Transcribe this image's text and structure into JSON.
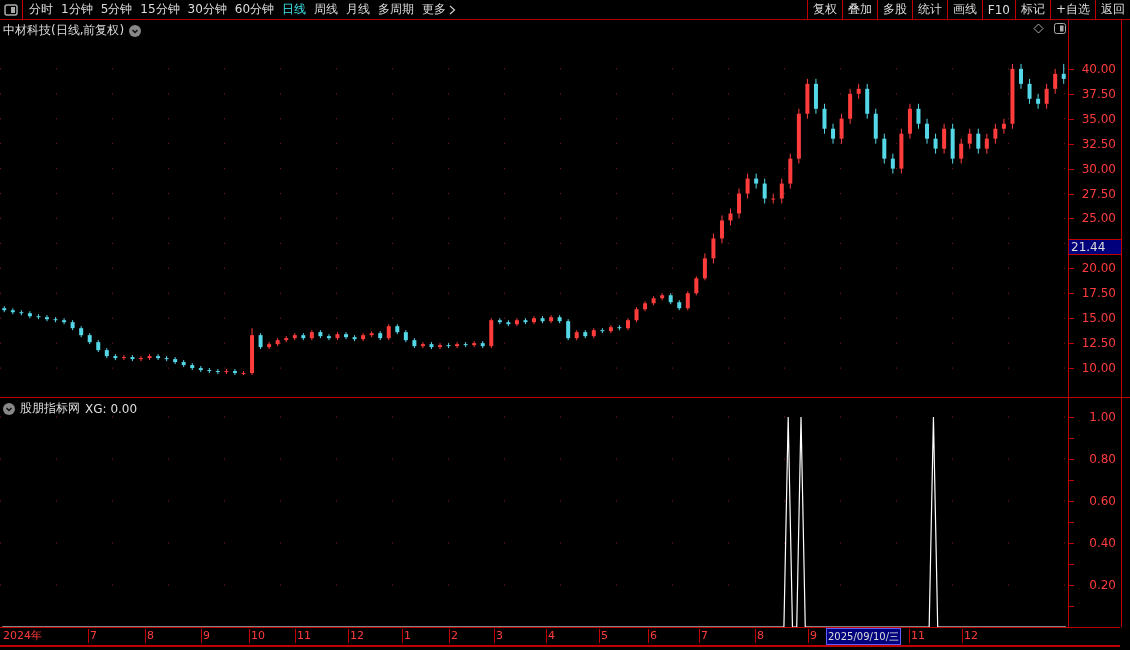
{
  "toolbar": {
    "periods": [
      {
        "label": "分时",
        "selected": false
      },
      {
        "label": "1分钟",
        "selected": false
      },
      {
        "label": "5分钟",
        "selected": false
      },
      {
        "label": "15分钟",
        "selected": false
      },
      {
        "label": "30分钟",
        "selected": false
      },
      {
        "label": "60分钟",
        "selected": false
      },
      {
        "label": "日线",
        "selected": true
      },
      {
        "label": "周线",
        "selected": false
      },
      {
        "label": "月线",
        "selected": false
      },
      {
        "label": "多周期",
        "selected": false
      },
      {
        "label": "更多",
        "selected": false
      }
    ],
    "actions": [
      "复权",
      "叠加",
      "多股",
      "统计",
      "画线",
      "F10",
      "标记",
      "+自选",
      "返回"
    ]
  },
  "price_pane": {
    "title": "中材科技(日线,前复权)",
    "cursor_price": "21.44",
    "chart_data": {
      "type": "candlestick",
      "grid": true,
      "ylim": [
        7.1,
        44.9
      ],
      "yticks": [
        {
          "value": 40,
          "label": "40.00"
        },
        {
          "value": 37.5,
          "label": "37.50"
        },
        {
          "value": 35,
          "label": "35.00"
        },
        {
          "value": 32.5,
          "label": "32.50"
        },
        {
          "value": 30,
          "label": "30.00"
        },
        {
          "value": 27.5,
          "label": "27.50"
        },
        {
          "value": 25,
          "label": "25.00"
        },
        {
          "value": 20,
          "label": "20.00"
        },
        {
          "value": 17.5,
          "label": "17.50"
        },
        {
          "value": 15,
          "label": "15.00"
        },
        {
          "value": 12.5,
          "label": "12.50"
        },
        {
          "value": 10,
          "label": "10.00"
        }
      ],
      "categories": [
        null,
        null,
        null,
        null,
        null,
        null,
        null,
        null,
        null,
        null,
        null,
        null,
        null,
        null,
        null,
        null,
        null,
        null,
        null,
        null,
        null,
        null,
        null,
        null,
        null,
        null,
        null,
        null,
        null,
        null,
        null,
        null,
        null,
        null,
        null,
        null,
        null,
        null,
        null,
        null,
        null,
        null,
        null,
        null,
        null,
        null,
        null,
        null,
        null,
        null,
        null,
        null,
        null,
        null,
        null,
        null,
        null,
        null,
        null,
        null,
        null,
        null,
        null,
        null,
        null,
        null,
        null,
        null,
        null,
        null,
        null,
        null,
        null,
        null,
        null,
        null,
        null,
        null,
        null,
        null,
        null,
        null,
        null,
        null,
        null,
        null,
        null,
        null,
        null,
        null,
        null,
        null,
        null,
        null,
        null,
        null,
        null,
        null,
        null,
        null,
        null,
        null,
        null,
        null,
        null,
        null,
        null,
        null,
        null,
        null,
        null,
        null,
        null,
        null,
        null,
        null,
        null,
        null,
        null,
        null,
        null,
        null,
        null,
        null,
        null
      ],
      "ohlc": [
        [
          16.0,
          16.2,
          15.6,
          15.8
        ],
        [
          15.8,
          16.0,
          15.4,
          15.6
        ],
        [
          15.6,
          15.8,
          15.3,
          15.5
        ],
        [
          15.5,
          15.7,
          15.0,
          15.2
        ],
        [
          15.2,
          15.4,
          14.9,
          15.1
        ],
        [
          15.1,
          15.3,
          14.7,
          14.9
        ],
        [
          14.9,
          15.1,
          14.6,
          14.8
        ],
        [
          14.8,
          15.0,
          14.4,
          14.6
        ],
        [
          14.6,
          14.8,
          13.8,
          14.0
        ],
        [
          14.0,
          14.2,
          13.1,
          13.3
        ],
        [
          13.3,
          13.5,
          12.4,
          12.6
        ],
        [
          12.6,
          12.8,
          11.6,
          11.8
        ],
        [
          11.8,
          12.0,
          11.0,
          11.2
        ],
        [
          11.2,
          11.4,
          10.8,
          11.0
        ],
        [
          11.0,
          11.3,
          10.8,
          11.1
        ],
        [
          11.1,
          11.3,
          10.7,
          10.9
        ],
        [
          10.9,
          11.2,
          10.7,
          11.0
        ],
        [
          11.0,
          11.4,
          10.8,
          11.2
        ],
        [
          11.2,
          11.4,
          10.8,
          11.0
        ],
        [
          11.0,
          11.2,
          10.7,
          10.9
        ],
        [
          10.9,
          11.1,
          10.4,
          10.6
        ],
        [
          10.6,
          10.8,
          10.1,
          10.3
        ],
        [
          10.3,
          10.5,
          9.8,
          10.0
        ],
        [
          10.0,
          10.2,
          9.6,
          9.8
        ],
        [
          9.8,
          10.0,
          9.5,
          9.7
        ],
        [
          9.7,
          9.9,
          9.4,
          9.6
        ],
        [
          9.6,
          9.9,
          9.4,
          9.7
        ],
        [
          9.7,
          9.9,
          9.3,
          9.5
        ],
        [
          9.5,
          9.7,
          9.3,
          9.5
        ],
        [
          9.5,
          14.0,
          9.3,
          13.3
        ],
        [
          13.3,
          13.5,
          11.9,
          12.1
        ],
        [
          12.1,
          12.6,
          11.9,
          12.4
        ],
        [
          12.4,
          13.0,
          12.2,
          12.8
        ],
        [
          12.8,
          13.2,
          12.6,
          13.0
        ],
        [
          13.0,
          13.5,
          12.8,
          13.3
        ],
        [
          13.3,
          13.5,
          12.8,
          13.0
        ],
        [
          13.0,
          13.8,
          12.8,
          13.6
        ],
        [
          13.6,
          13.8,
          13.0,
          13.2
        ],
        [
          13.2,
          13.4,
          12.8,
          13.0
        ],
        [
          13.0,
          13.6,
          12.8,
          13.4
        ],
        [
          13.4,
          13.6,
          12.9,
          13.1
        ],
        [
          13.1,
          13.3,
          12.7,
          12.9
        ],
        [
          12.9,
          13.5,
          12.7,
          13.3
        ],
        [
          13.3,
          13.7,
          13.1,
          13.5
        ],
        [
          13.5,
          13.7,
          12.8,
          13.0
        ],
        [
          13.0,
          14.4,
          12.8,
          14.2
        ],
        [
          14.2,
          14.4,
          13.4,
          13.6
        ],
        [
          13.6,
          13.8,
          12.6,
          12.8
        ],
        [
          12.8,
          13.0,
          12.0,
          12.2
        ],
        [
          12.2,
          12.6,
          12.0,
          12.4
        ],
        [
          12.4,
          12.6,
          11.9,
          12.1
        ],
        [
          12.1,
          12.5,
          11.9,
          12.3
        ],
        [
          12.3,
          12.5,
          12.0,
          12.2
        ],
        [
          12.2,
          12.6,
          12.0,
          12.4
        ],
        [
          12.4,
          12.6,
          12.1,
          12.3
        ],
        [
          12.3,
          12.7,
          12.1,
          12.5
        ],
        [
          12.5,
          12.7,
          12.0,
          12.2
        ],
        [
          12.2,
          15.0,
          12.0,
          14.8
        ],
        [
          14.8,
          15.0,
          14.4,
          14.6
        ],
        [
          14.6,
          14.8,
          14.2,
          14.4
        ],
        [
          14.4,
          15.0,
          14.2,
          14.8
        ],
        [
          14.8,
          15.0,
          14.4,
          14.6
        ],
        [
          14.6,
          15.2,
          14.4,
          15.0
        ],
        [
          15.0,
          15.2,
          14.5,
          14.7
        ],
        [
          14.7,
          15.3,
          14.5,
          15.1
        ],
        [
          15.1,
          15.3,
          14.5,
          14.7
        ],
        [
          14.7,
          14.9,
          12.8,
          13.0
        ],
        [
          13.0,
          13.8,
          12.8,
          13.6
        ],
        [
          13.6,
          13.8,
          13.0,
          13.2
        ],
        [
          13.2,
          14.0,
          13.0,
          13.8
        ],
        [
          13.8,
          14.0,
          13.5,
          13.7
        ],
        [
          13.7,
          14.3,
          13.5,
          14.1
        ],
        [
          14.1,
          14.3,
          13.8,
          14.0
        ],
        [
          14.0,
          15.0,
          13.8,
          14.8
        ],
        [
          14.8,
          16.1,
          14.6,
          15.9
        ],
        [
          15.9,
          16.7,
          15.7,
          16.5
        ],
        [
          16.5,
          17.2,
          16.3,
          17.0
        ],
        [
          17.0,
          17.5,
          16.8,
          17.3
        ],
        [
          17.3,
          17.5,
          16.4,
          16.6
        ],
        [
          16.6,
          16.8,
          15.8,
          16.0
        ],
        [
          16.0,
          17.7,
          15.8,
          17.5
        ],
        [
          17.5,
          19.2,
          17.3,
          19.0
        ],
        [
          19.0,
          21.5,
          18.8,
          21.0
        ],
        [
          21.0,
          23.5,
          20.5,
          23.0
        ],
        [
          23.0,
          25.3,
          22.5,
          24.8
        ],
        [
          24.8,
          26.0,
          24.3,
          25.5
        ],
        [
          25.5,
          28.0,
          25.0,
          27.5
        ],
        [
          27.5,
          29.5,
          27.0,
          29.0
        ],
        [
          29.0,
          29.5,
          28.0,
          28.5
        ],
        [
          28.5,
          29.0,
          26.5,
          27.0
        ],
        [
          27.0,
          27.5,
          26.5,
          27.0
        ],
        [
          27.0,
          29.0,
          26.5,
          28.5
        ],
        [
          28.5,
          31.5,
          28.0,
          31.0
        ],
        [
          31.0,
          36.0,
          30.5,
          35.5
        ],
        [
          35.5,
          39.0,
          35.0,
          38.5
        ],
        [
          38.5,
          39.0,
          35.5,
          36.0
        ],
        [
          36.0,
          36.5,
          33.5,
          34.0
        ],
        [
          34.0,
          34.5,
          32.5,
          33.0
        ],
        [
          33.0,
          35.5,
          32.5,
          35.0
        ],
        [
          35.0,
          38.0,
          34.5,
          37.5
        ],
        [
          37.5,
          38.5,
          37.0,
          38.0
        ],
        [
          38.0,
          38.5,
          35.0,
          35.5
        ],
        [
          35.5,
          36.0,
          32.5,
          33.0
        ],
        [
          33.0,
          33.5,
          30.5,
          31.0
        ],
        [
          31.0,
          31.5,
          29.5,
          30.0
        ],
        [
          30.0,
          34.0,
          29.5,
          33.5
        ],
        [
          33.5,
          36.5,
          33.0,
          36.0
        ],
        [
          36.0,
          36.5,
          34.0,
          34.5
        ],
        [
          34.5,
          35.0,
          32.5,
          33.0
        ],
        [
          33.0,
          33.5,
          31.5,
          32.0
        ],
        [
          32.0,
          34.5,
          31.5,
          34.0
        ],
        [
          34.0,
          34.5,
          30.5,
          31.0
        ],
        [
          31.0,
          33.0,
          30.5,
          32.5
        ],
        [
          32.5,
          34.0,
          32.0,
          33.5
        ],
        [
          33.5,
          34.0,
          31.5,
          32.0
        ],
        [
          32.0,
          33.5,
          31.5,
          33.0
        ],
        [
          33.0,
          34.5,
          32.5,
          34.0
        ],
        [
          34.0,
          35.0,
          33.5,
          34.5
        ],
        [
          34.5,
          40.5,
          34.0,
          40.0
        ],
        [
          40.0,
          40.5,
          38.0,
          38.5
        ],
        [
          38.5,
          39.0,
          36.5,
          37.0
        ],
        [
          37.0,
          37.5,
          36.0,
          36.5
        ],
        [
          36.5,
          38.5,
          36.0,
          38.0
        ],
        [
          38.0,
          40.0,
          37.5,
          39.5
        ],
        [
          39.5,
          40.5,
          38.5,
          39.0
        ]
      ]
    }
  },
  "indicator_pane": {
    "title": "股朋指标网",
    "reading": "XG: 0.00",
    "chart_data": {
      "type": "line",
      "grid": true,
      "ylim": [
        0,
        1
      ],
      "yticks": [
        {
          "value": 1,
          "label": "1.00"
        },
        {
          "value": 0.8,
          "label": "0.80"
        },
        {
          "value": 0.6,
          "label": "0.60"
        },
        {
          "value": 0.4,
          "label": "0.40"
        },
        {
          "value": 0.2,
          "label": "0.20"
        }
      ],
      "series": [
        {
          "color": "#ffffff",
          "values": [
            0,
            0,
            0,
            0,
            0,
            0,
            0,
            0,
            0,
            0,
            0,
            0,
            0,
            0,
            0,
            0,
            0,
            0,
            0,
            0,
            0,
            0,
            0,
            0,
            0,
            0,
            0,
            0,
            0,
            0,
            0,
            0,
            0,
            0,
            0,
            0,
            0,
            0,
            0,
            0,
            0,
            0,
            0,
            0,
            0,
            0,
            0,
            0,
            0,
            0,
            0,
            0,
            0,
            0,
            0,
            0,
            0,
            0,
            0,
            0,
            0,
            0,
            0,
            0,
            0,
            0,
            0,
            0,
            0,
            0,
            0,
            0,
            0,
            0,
            0,
            0,
            0,
            0,
            0,
            0,
            0,
            0,
            0,
            0,
            0,
            0,
            0,
            0,
            0,
            0,
            0,
            0,
            0,
            0,
            0,
            0,
            0,
            0,
            0,
            0,
            0,
            0,
            0,
            0,
            0,
            0,
            0,
            0,
            0,
            0,
            0,
            0,
            0,
            0,
            0,
            0,
            0,
            0,
            0,
            0,
            0,
            0,
            0,
            0,
            0,
            0,
            0,
            0,
            0,
            0,
            0,
            0,
            0,
            0,
            0,
            0,
            0,
            0,
            0,
            0,
            0,
            0,
            0,
            0,
            0,
            0,
            0,
            0,
            0,
            0,
            0,
            0,
            0,
            0,
            0,
            0,
            0,
            0,
            0,
            0,
            0,
            0,
            0,
            0,
            0,
            0,
            0,
            0,
            0,
            0,
            0,
            0,
            0,
            0,
            0,
            0,
            0,
            0,
            0,
            0,
            0,
            0,
            0,
            0,
            1,
            0,
            0,
            1,
            0,
            0,
            0,
            0,
            0,
            0,
            0,
            0,
            0,
            0,
            0,
            0,
            0,
            0,
            0,
            0,
            0,
            0,
            0,
            0,
            0,
            0,
            0,
            0,
            0,
            0,
            0,
            0,
            0,
            0,
            1,
            0,
            0,
            0,
            0,
            0,
            0,
            0,
            0,
            0,
            0,
            0,
            0,
            0,
            0,
            0,
            0,
            0,
            0,
            0,
            0,
            0,
            0,
            0,
            0,
            0,
            0,
            0,
            0,
            0,
            0,
            0
          ]
        }
      ]
    }
  },
  "date_axis": {
    "labels": [
      {
        "text": "2024年",
        "kind": "month"
      },
      {
        "text": "7",
        "kind": "month"
      },
      {
        "text": "8",
        "kind": "month"
      },
      {
        "text": "9",
        "kind": "month"
      },
      {
        "text": "10",
        "kind": "month"
      },
      {
        "text": "11",
        "kind": "month"
      },
      {
        "text": "12",
        "kind": "month"
      },
      {
        "text": "1",
        "kind": "month"
      },
      {
        "text": "2",
        "kind": "month"
      },
      {
        "text": "3",
        "kind": "month"
      },
      {
        "text": "4",
        "kind": "month"
      },
      {
        "text": "5",
        "kind": "month"
      },
      {
        "text": "6",
        "kind": "month"
      },
      {
        "text": "7",
        "kind": "month"
      },
      {
        "text": "8",
        "kind": "month"
      },
      {
        "text": "9",
        "kind": "month"
      },
      {
        "text": "2025/09/10/三",
        "kind": "cursor"
      },
      {
        "text": "11",
        "kind": "month"
      },
      {
        "text": "12",
        "kind": "month"
      }
    ]
  }
}
